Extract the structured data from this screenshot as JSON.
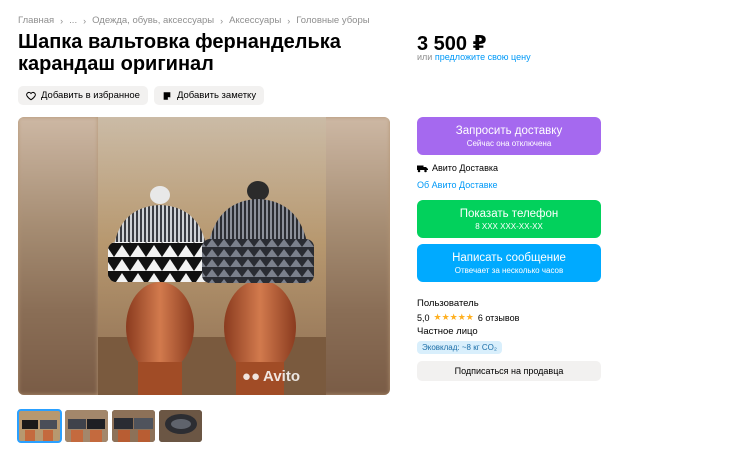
{
  "breadcrumb": {
    "items": [
      "Главная",
      "...",
      "Одежда, обувь, аксессуары",
      "Аксессуары",
      "Головные уборы"
    ]
  },
  "listing": {
    "title": "Шапка вальтовка фернанделька карандаш оригинал",
    "favorite_label": "Добавить в избранное",
    "note_label": "Добавить заметку",
    "watermark": "Avito",
    "thumbnail_count": 4,
    "active_thumbnail": 1
  },
  "price": {
    "value": "3 500 ₽",
    "or_text": "или",
    "offer_link": "предложите свою цену"
  },
  "delivery": {
    "request_label": "Запросить доставку",
    "request_sub": "Сейчас она отключена",
    "service_label": "Авито Доставка",
    "about_link": "Об Авито Доставке"
  },
  "contact": {
    "phone_label": "Показать телефон",
    "phone_masked": "8 XXX XXX-XX-XX",
    "message_label": "Написать сообщение",
    "message_sub": "Отвечает за несколько часов"
  },
  "seller": {
    "name": "Пользователь",
    "rating": "5,0",
    "stars": "★★★★★",
    "reviews": "6 отзывов",
    "type": "Частное лицо",
    "eco": "Эковклад: ~8 кг CO₂",
    "subscribe_label": "Подписаться на продавца"
  },
  "colors": {
    "delivery_button": "#a569ef",
    "phone_button": "#02d15c",
    "message_button": "#00aaff",
    "link": "#0099f7",
    "stars": "#ffb021"
  }
}
